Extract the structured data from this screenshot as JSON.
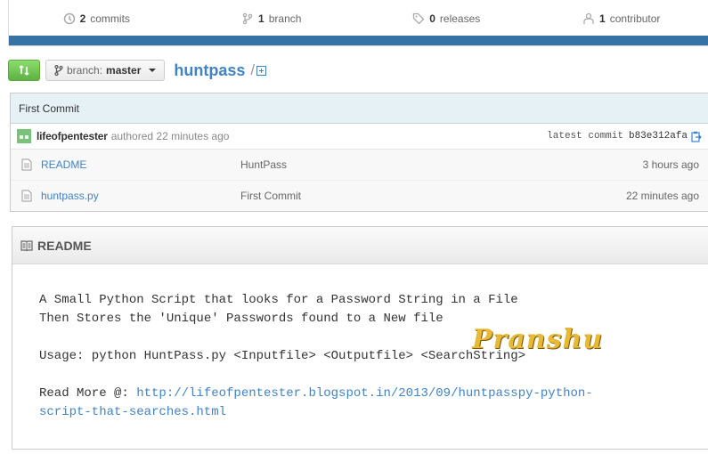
{
  "stats": {
    "commits_count": "2",
    "commits_label": "commits",
    "branches_count": "1",
    "branches_label": "branch",
    "releases_count": "0",
    "releases_label": "releases",
    "contributors_count": "1",
    "contributors_label": "contributor"
  },
  "colors": {
    "language_bar": "#3572A5",
    "link": "#4183c4",
    "compare_button": "#60b044"
  },
  "toolbar": {
    "compare_icon": "compare-arrows-icon",
    "branch_prefix": "branch:",
    "branch_name": "master",
    "repo_name": "huntpass",
    "path_separator": "/"
  },
  "commit": {
    "title": "First Commit",
    "author": "lifeofpentester",
    "authored": "authored 22 minutes ago",
    "latest_label": "latest commit",
    "sha": "b83e312afa"
  },
  "files": [
    {
      "name": "README",
      "message": "HuntPass",
      "age": "3 hours ago"
    },
    {
      "name": "huntpass.py",
      "message": "First Commit",
      "age": "22 minutes ago"
    }
  ],
  "readme": {
    "heading": "README",
    "line1": "A Small Python Script that looks for a Password String in a File",
    "line2": "Then Stores the 'Unique' Passwords found to a New file",
    "line3": "Usage: python HuntPass.py <Inputfile> <Outputfile> <SearchString>",
    "line4_prefix": "Read More @: ",
    "link_part1": "http://lifeofpentester.blogspot.in/2013/09/huntpasspy-python-",
    "link_part2": "script-that-searches.html"
  },
  "watermark": "Pranshu"
}
